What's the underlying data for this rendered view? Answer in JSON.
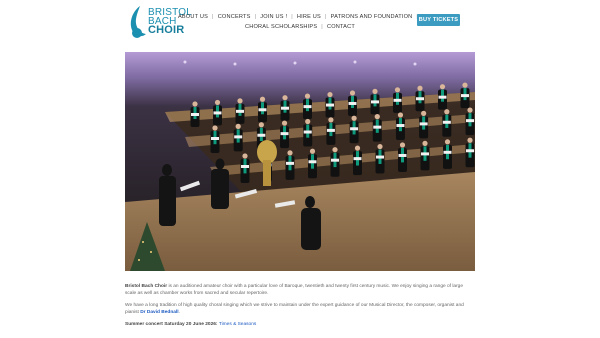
{
  "header": {
    "logo": {
      "line1": "BRISTOL",
      "line2": "BACH",
      "line3": "CHOIR"
    },
    "nav_row1": [
      "ABOUT US",
      "CONCERTS",
      "JOIN US !",
      "HIRE US",
      "PATRONS AND FOUNDATION"
    ],
    "nav_row2": [
      "CHORAL SCHOLARSHIPS",
      "CONTACT"
    ],
    "buy_button": "BUY TICKETS"
  },
  "colors": {
    "accent": "#3c9bc0",
    "logo": "#1b8fb0",
    "link": "#1d5ac2",
    "scarf": "#0f9c7e"
  },
  "photo": {
    "subject": "choir-performance-photo"
  },
  "intro": {
    "p1_name": "Bristol Bach Choir",
    "p1_text": " is an auditioned amateur choir with a particular love of Baroque, twentieth and twenty first century music. We enjoy singing a range of large scale as well as chamber works from sacred and secular repertoire.",
    "p2_text": "We have a long tradition of high quality choral singing which we strive to maintain under the expert guidance of our Musical Director, the composer, organist and pianist ",
    "p2_link": "Dr David Bednall",
    "p2_end": ".",
    "p3_label": "Summer concert Saturday 20 June 2026: ",
    "p3_link": "Times & Seasons"
  }
}
